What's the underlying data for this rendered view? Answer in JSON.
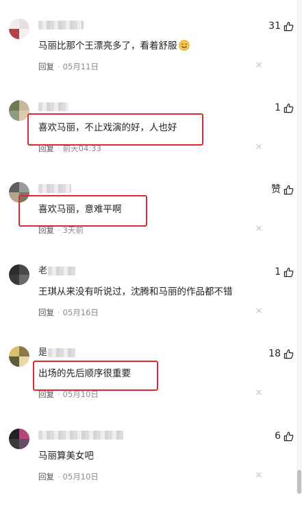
{
  "comments": [
    {
      "username": "",
      "likes": "31",
      "text": "马丽比那个王漂亮多了，看着舒服",
      "emoji": "smile-emoji",
      "reply_label": "回复",
      "date": "05月11日",
      "avatar_colors": [
        "#f2eded",
        "#e8e0e0",
        "#b2424a",
        "#f4f0f0"
      ]
    },
    {
      "username": "",
      "likes": "1",
      "text": "喜欢马丽，不止戏演的好，人也好",
      "reply_label": "回复",
      "date": "前天04:33",
      "avatar_colors": [
        "#6b7c55",
        "#c9b79b",
        "#8f9c80",
        "#d9c9b0"
      ]
    },
    {
      "username": "",
      "likes": "赞",
      "text": "喜欢马丽，意难平啊",
      "reply_label": "回复",
      "date": "3天前",
      "avatar_colors": [
        "#5e5e5e",
        "#9b9b9b",
        "#b8a48a",
        "#7e7466"
      ]
    },
    {
      "username": "老",
      "likes": "1",
      "text": "王琪从来没有听说过，沈腾和马丽的作品都不错",
      "reply_label": "回复",
      "date": "05月16日",
      "avatar_colors": [
        "#2c2c2c",
        "#4a4a4a",
        "#3a3a3a",
        "#6a6a6a"
      ]
    },
    {
      "username": "是",
      "likes": "18",
      "text": "出场的先后顺序很重要",
      "reply_label": "回复",
      "date": "05月10日",
      "avatar_colors": [
        "#d9c070",
        "#8a7a4a",
        "#5c5c3a",
        "#e6d8a8"
      ]
    },
    {
      "username": "",
      "likes": "6",
      "text": "马丽算美女吧",
      "reply_label": "回复",
      "date": "05月10日",
      "avatar_colors": [
        "#222222",
        "#b04a7a",
        "#3a3a3a",
        "#6a4a6a"
      ]
    }
  ],
  "colors": {
    "highlight": "#e0272c",
    "meta_text": "#8a8a8a"
  }
}
